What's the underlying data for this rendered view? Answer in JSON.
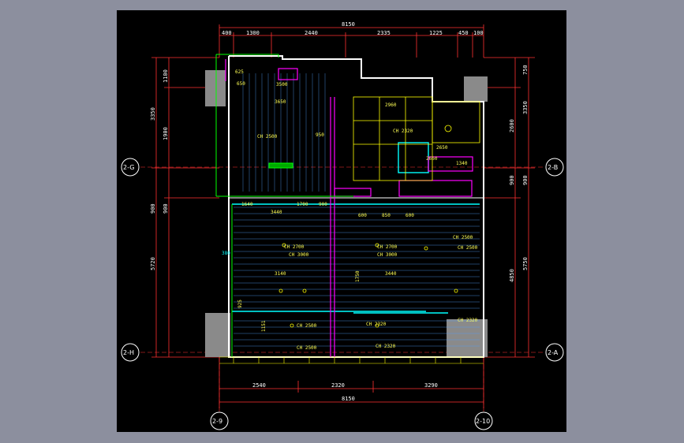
{
  "drawing": {
    "top_dims": [
      "400",
      "1300",
      "2440",
      "2335",
      "1225",
      "450",
      "100"
    ],
    "top_total": "8150",
    "bottom_dims": [
      "2540",
      "2320",
      "3290"
    ],
    "bottom_total": "8150",
    "left_outer": [
      "3350",
      "5720"
    ],
    "left_inner": [
      "1100",
      "1900",
      "900",
      "900"
    ],
    "right_outer": [
      "750",
      "3350",
      "900",
      "5750"
    ],
    "right_inner": [
      "2600",
      "900",
      "4850"
    ],
    "axes": {
      "left_top": "2-G",
      "left_bottom": "2-H",
      "right_top": "2-B",
      "right_bottom": "2-A",
      "bottom_left": "2-9",
      "bottom_right": "2-10"
    },
    "room_labels": [
      "CH 2500",
      "CH 2320",
      "CH 3000",
      "CH 2700",
      "CH 3000",
      "CH 2700",
      "CH 2500",
      "CH 2500",
      "CH 2320",
      "CH 2500",
      "CH 2320",
      "CH 2500",
      "CH 2320"
    ],
    "inner_dims": [
      "3440",
      "1700",
      "900",
      "600",
      "850",
      "600",
      "3140",
      "3440",
      "1750",
      "1151",
      "2660",
      "3650",
      "2960",
      "1340",
      "2650",
      "650",
      "950",
      "1640",
      "3500",
      "380",
      "625",
      "925"
    ]
  },
  "colors": {
    "background": "#000000",
    "frame": "#8c8f9e",
    "dim": "#ff3030",
    "wall": "#ffffff",
    "accent": "#00ffff",
    "green": "#00ff00",
    "yellow": "#ffff00",
    "magenta": "#ff00ff"
  }
}
